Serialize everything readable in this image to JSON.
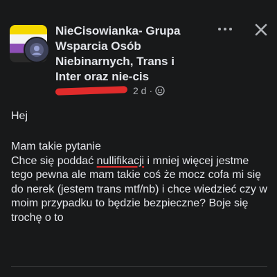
{
  "post": {
    "group_name": "NieCisowianka- Grupa Wsparcia Osób Niebinarnych, Trans i Inter oraz nie-cis",
    "time": "2 d",
    "separator": "·",
    "more_icon": "more-horizontal-icon",
    "close_icon": "close-icon",
    "privacy_icon": "globe-icon",
    "greeting": "Hej",
    "question_intro": "Mam takie pytanie",
    "body_before": "Chce się poddać ",
    "body_highlight": "nullifikacji",
    "body_after": " i mniej więcej jestme tego pewna ale mam takie coś że mocz cofa mi się do nerek (jestem trans mtf/nb) i chce wiedzieć czy w moim przypadku to będzie bezpieczne? Boje się trochę o to"
  },
  "colors": {
    "background": "#18191a",
    "text": "#e4e6eb",
    "secondary_text": "#b0b3b8",
    "redaction": "#e02b2b",
    "flag_yellow": "#f5d800",
    "flag_white": "#f4f4f4",
    "flag_purple": "#8e4fb6",
    "flag_black": "#2a2a2a"
  }
}
